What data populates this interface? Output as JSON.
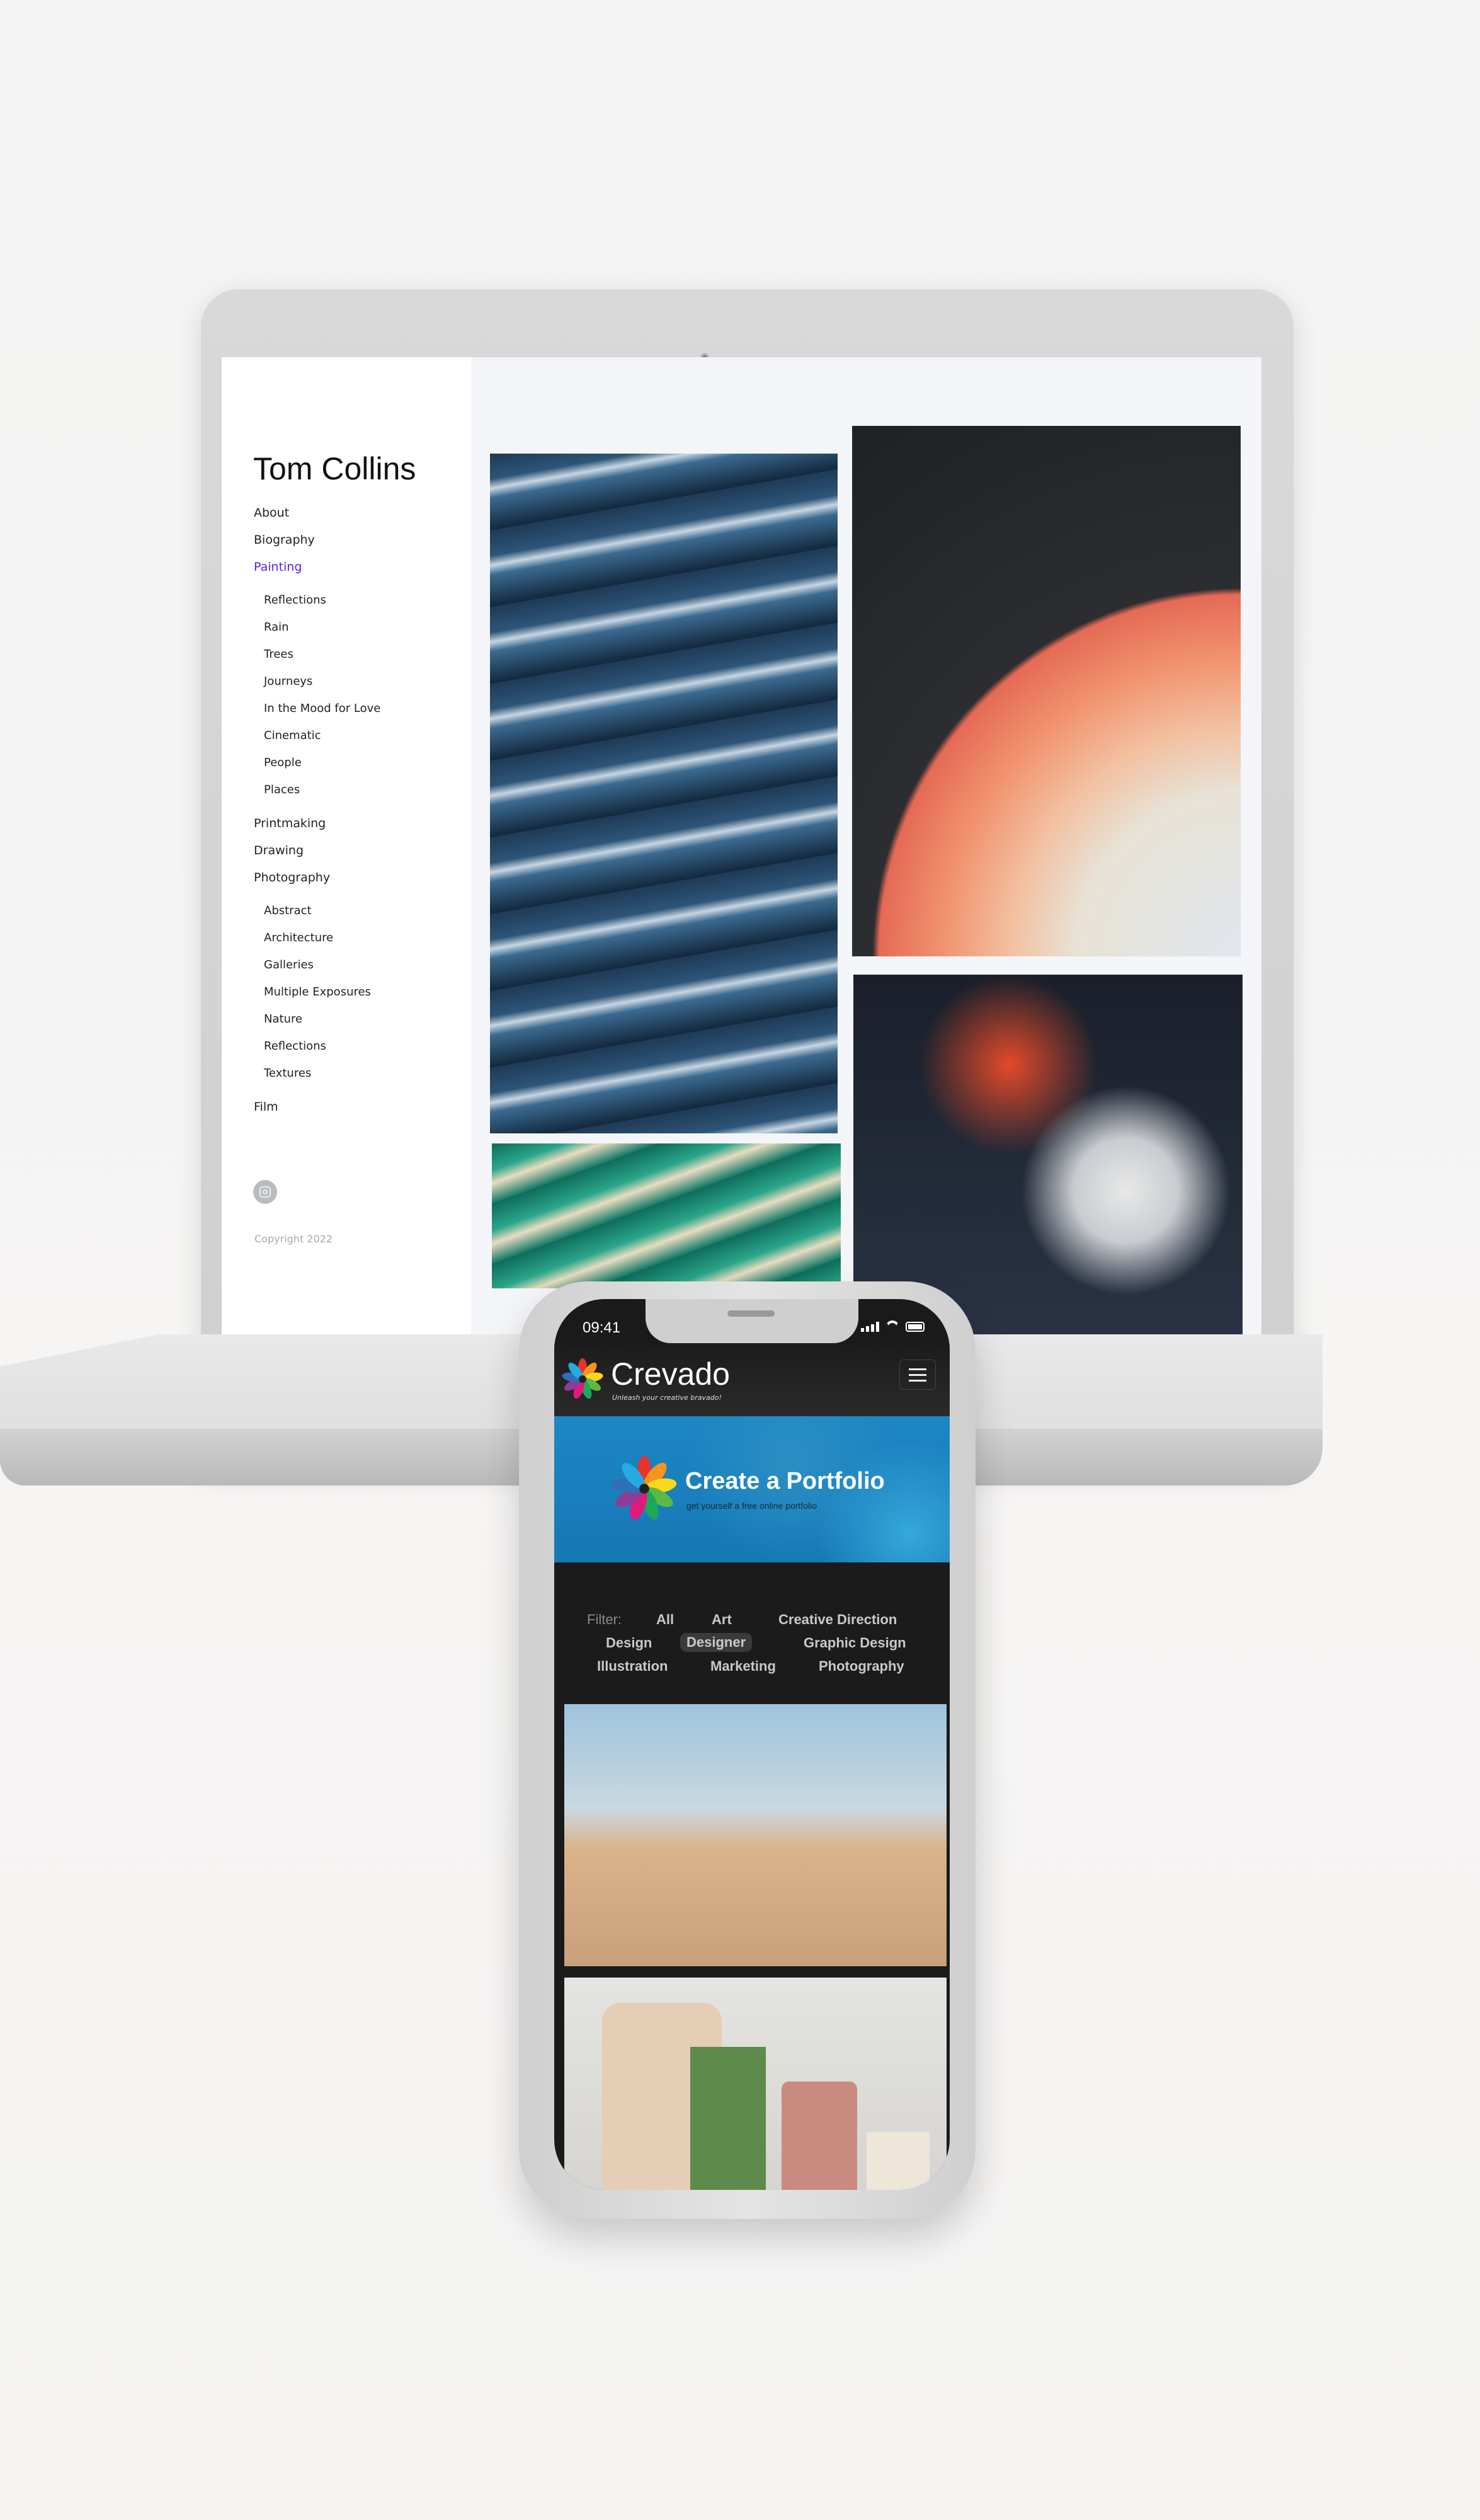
{
  "laptop": {
    "site_title": "Tom Collins",
    "nav": [
      {
        "label": "About"
      },
      {
        "label": "Biography"
      },
      {
        "label": "Painting",
        "active": true
      },
      {
        "label": "Reflections",
        "sub": true
      },
      {
        "label": "Rain",
        "sub": true
      },
      {
        "label": "Trees",
        "sub": true
      },
      {
        "label": "Journeys",
        "sub": true
      },
      {
        "label": "In the Mood for Love",
        "sub": true
      },
      {
        "label": "Cinematic",
        "sub": true
      },
      {
        "label": "People",
        "sub": true
      },
      {
        "label": "Places",
        "sub": true
      },
      {
        "label": "Printmaking"
      },
      {
        "label": "Drawing"
      },
      {
        "label": "Photography"
      },
      {
        "label": "Abstract",
        "sub": true
      },
      {
        "label": "Architecture",
        "sub": true
      },
      {
        "label": "Galleries",
        "sub": true
      },
      {
        "label": "Multiple Exposures",
        "sub": true
      },
      {
        "label": "Nature",
        "sub": true
      },
      {
        "label": "Reflections",
        "sub": true
      },
      {
        "label": "Textures",
        "sub": true
      },
      {
        "label": "Film"
      }
    ],
    "social_icon": "instagram-icon",
    "copyright": "Copyright 2022",
    "active_color": "#5a22d6"
  },
  "phone": {
    "time": "09:41",
    "brand": "Crevado",
    "tagline": "Unleash your creative bravado!",
    "menu_icon": "hamburger-icon",
    "banner": {
      "title": "Create a Portfolio",
      "subtitle": "get yourself a free online portfolio",
      "color": "#1a80bf"
    },
    "filter": {
      "label": "Filter:",
      "options": [
        "All",
        "Art",
        "Creative Direction",
        "Design",
        "Designer",
        "Graphic Design",
        "Illustration",
        "Marketing",
        "Photography"
      ],
      "selected": "Designer"
    }
  }
}
